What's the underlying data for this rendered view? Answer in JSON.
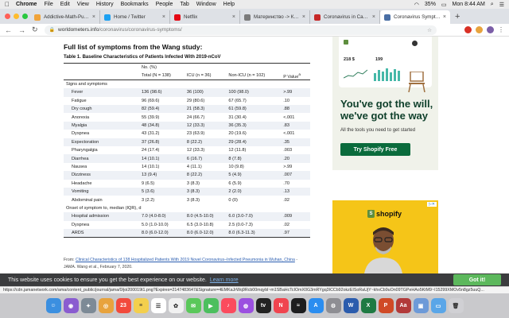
{
  "menubar": {
    "app": "Chrome",
    "items": [
      "File",
      "Edit",
      "View",
      "History",
      "Bookmarks",
      "People",
      "Tab",
      "Window",
      "Help"
    ],
    "battery": "35%",
    "clock": "Mon 8:44 AM"
  },
  "tabs": [
    {
      "label": "Addictive-Math-Puzzles-G...",
      "color": "#f0a33a",
      "icon": "puzzle-icon"
    },
    {
      "label": "Home / Twitter",
      "color": "#1da1f2",
      "icon": "twitter-icon"
    },
    {
      "label": "Netflix",
      "color": "#e50914",
      "icon": "netflix-icon"
    },
    {
      "label": "Материнство -> Коронави...",
      "color": "#7b7b7b",
      "icon": "page-icon"
    },
    {
      "label": "Coronavirus in Canada: 'Br...",
      "color": "#c62828",
      "icon": "news-icon"
    },
    {
      "label": "Coronavirus Symptoms (C...",
      "color": "#4a6fa5",
      "icon": "worldometers-icon"
    }
  ],
  "address": {
    "host": "worldometers.info",
    "path": "/coronavirus/coronavirus-symptoms/"
  },
  "article": {
    "heading": "Full list of symptoms from the Wang study:",
    "caption": "Table 1. Baseline Characteristics of Patients Infected With 2019-nCoV",
    "col_group": "No. (%)",
    "columns": [
      "",
      "Total (N = 138)",
      "ICU (n = 36)",
      "Non-ICU (n = 102)",
      "P Value"
    ],
    "p_sup": "a",
    "section1": "Signs and symptoms",
    "rows1": [
      [
        "Fever",
        "136 (98.6)",
        "36 (100)",
        "100 (98.0)",
        ">.99"
      ],
      [
        "Fatigue",
        "96 (69.6)",
        "29 (80.6)",
        "67 (65.7)",
        ".10"
      ],
      [
        "Dry cough",
        "82 (59.4)",
        "21 (58.3)",
        "61 (59.8)",
        ".88"
      ],
      [
        "Anorexia",
        "55 (39.9)",
        "24 (66.7)",
        "31 (30.4)",
        "<.001"
      ],
      [
        "Myalgia",
        "48 (34.8)",
        "12 (33.3)",
        "36 (35.3)",
        ".83"
      ],
      [
        "Dyspnea",
        "43 (31.2)",
        "23 (63.9)",
        "20 (19.6)",
        "<.001"
      ],
      [
        "Expectoration",
        "37 (26.8)",
        "8 (22.2)",
        "29 (28.4)",
        ".35"
      ],
      [
        "Pharyngalgia",
        "24 (17.4)",
        "12 (33.3)",
        "12 (11.8)",
        ".003"
      ],
      [
        "Diarrhea",
        "14 (10.1)",
        "6 (16.7)",
        "8 (7.8)",
        ".20"
      ],
      [
        "Nausea",
        "14 (10.1)",
        "4 (11.1)",
        "10 (9.8)",
        ">.99"
      ],
      [
        "Dizziness",
        "13 (9.4)",
        "8 (22.2)",
        "5 (4.9)",
        ".007"
      ],
      [
        "Headache",
        "9 (6.5)",
        "3 (8.3)",
        "6 (5.9)",
        ".70"
      ],
      [
        "Vomiting",
        "5 (3.6)",
        "3 (8.3)",
        "2 (2.0)",
        ".13"
      ],
      [
        "Abdominal pain",
        "3 (2.2)",
        "3 (8.3)",
        "0 (0)",
        ".02"
      ]
    ],
    "section2": "Onset of symptom to, median (IQR), d",
    "rows2": [
      [
        "Hospital admission",
        "7.0 (4.0-8.0)",
        "8.0 (4.5-10.0)",
        "6.0 (3.0-7.0)",
        ".009"
      ],
      [
        "Dyspnea",
        "5.0 (1.0-10.0)",
        "6.5 (3.0-10.8)",
        "2.5 (0.0-7.3)",
        ".02"
      ],
      [
        "ARDS",
        "8.0 (6.0-12.0)",
        "8.0 (6.0-12.0)",
        "8.0 (6.3-11.3)",
        ".97"
      ]
    ],
    "source_prefix": "From:",
    "source_link": "Clinical Characteristics of 138 Hospitalized Patients With 2019 Novel Coronavirus–Infected Pneumonia in Wuhan, China",
    "source_suffix": "-",
    "citation": "JAMA. Wang et al., February 7, 2020."
  },
  "ad1": {
    "stat1": "218 $",
    "stat2": "199",
    "headline": "You've got the will, we've got the way",
    "sub": "All the tools you need to get started",
    "button": "Try Shopify Free"
  },
  "ad2": {
    "brand": "shopify",
    "adchoice": "▷✕"
  },
  "cookie": {
    "text": "This website uses cookies to ensure you get the best experience on our website.",
    "learn": "Learn more",
    "button": "Got it!"
  },
  "statusbar": "https://cdn.jamanetwork.com/ama/content_public/journal/jama/0/joi200019t1.png?Expires=2147483647&Signature=4EMKaJrWq9Rcb00mqybl~m1SBaHcTcIOmX0G3mRYgq3ICCb92okzEISoRaUjY~khxCb9uOn09TGPeHAo5KtM9~I15299XMOv5n8gz5uuQ...",
  "dock": [
    {
      "name": "finder-icon",
      "color": "#3b8fe0",
      "glyph": "☺"
    },
    {
      "name": "siri-icon",
      "color": "#8a5cd0",
      "glyph": "◉"
    },
    {
      "name": "launchpad-icon",
      "color": "#7d8a96",
      "glyph": "✦"
    },
    {
      "name": "chrome-icon",
      "color": "#e8a33d",
      "glyph": "◎"
    },
    {
      "name": "calendar-icon",
      "color": "#f24a3c",
      "glyph": "23"
    },
    {
      "name": "notes-icon",
      "color": "#f3cf4d",
      "glyph": "≡"
    },
    {
      "name": "reminders-icon",
      "color": "#ffffff",
      "glyph": "☰"
    },
    {
      "name": "photos-icon",
      "color": "#f1f1f1",
      "glyph": "✿"
    },
    {
      "name": "messages-icon",
      "color": "#5ac85a",
      "glyph": "✉"
    },
    {
      "name": "facetime-icon",
      "color": "#4cbf5e",
      "glyph": "▶"
    },
    {
      "name": "music-icon",
      "color": "#fb4b5e",
      "glyph": "♪"
    },
    {
      "name": "podcasts-icon",
      "color": "#9b4fe0",
      "glyph": "◍"
    },
    {
      "name": "tv-icon",
      "color": "#222222",
      "glyph": "tv"
    },
    {
      "name": "news-icon",
      "color": "#f0444f",
      "glyph": "N"
    },
    {
      "name": "stocks-icon",
      "color": "#1d1d1f",
      "glyph": "≈"
    },
    {
      "name": "appstore-icon",
      "color": "#2a8df0",
      "glyph": "A"
    },
    {
      "name": "settings-icon",
      "color": "#8e8e93",
      "glyph": "⚙"
    },
    {
      "name": "word-icon",
      "color": "#2b5cad",
      "glyph": "W"
    },
    {
      "name": "excel-icon",
      "color": "#1f7a43",
      "glyph": "X"
    },
    {
      "name": "powerpoint-icon",
      "color": "#d04a26",
      "glyph": "P"
    },
    {
      "name": "dictionary-icon",
      "color": "#b23a3a",
      "glyph": "Aa"
    },
    {
      "name": "preview-icon",
      "color": "#6d9ad8",
      "glyph": "▣"
    },
    {
      "name": "folder-icon",
      "color": "#5aa6e8",
      "glyph": "▭"
    },
    {
      "name": "trash-icon",
      "color": "#d0d0d4",
      "glyph": "🗑"
    }
  ]
}
